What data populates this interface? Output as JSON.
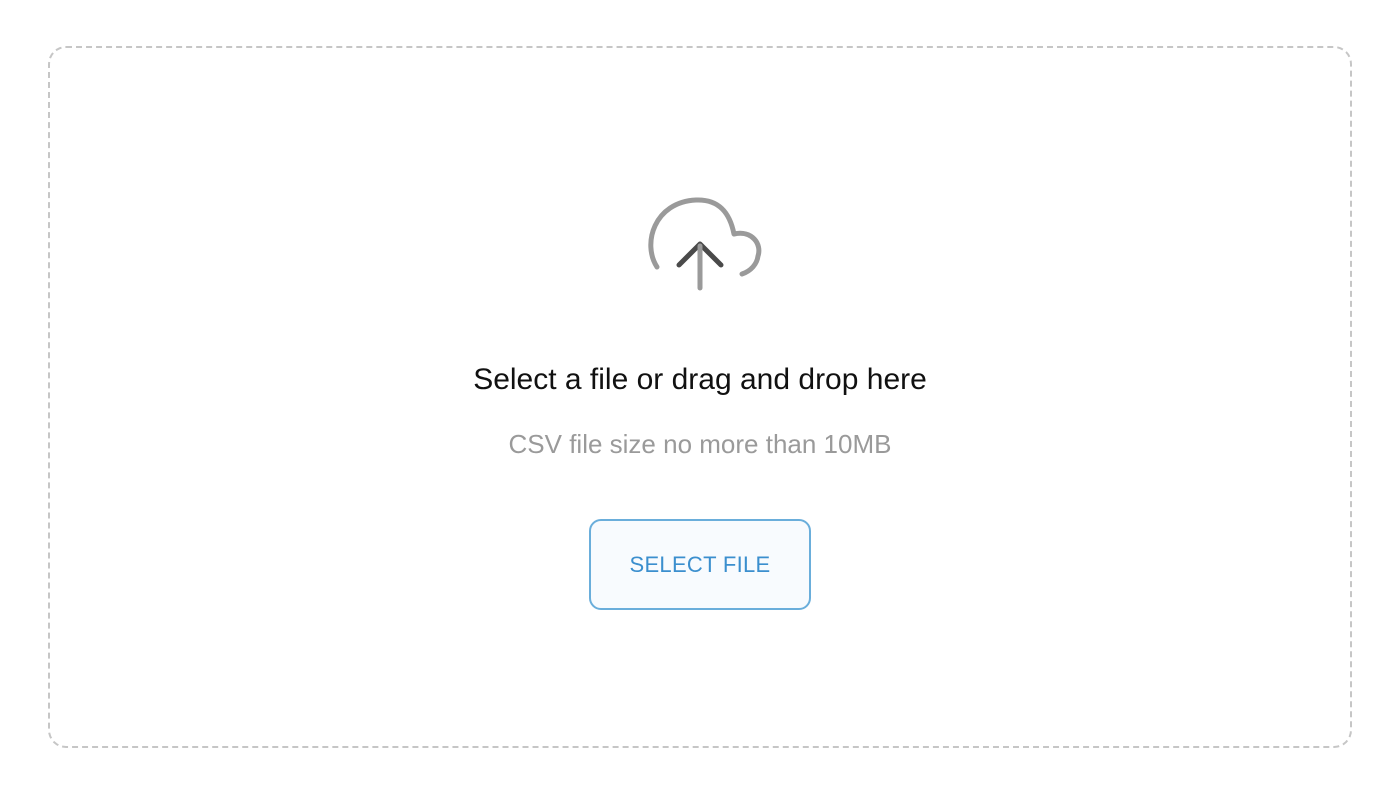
{
  "upload": {
    "icon": "cloud-upload-icon",
    "title": "Select a file or drag and drop here",
    "subtitle": "CSV file size no more than 10MB",
    "button_label": "SELECT FILE"
  },
  "colors": {
    "dashed_border": "#c6c6c6",
    "icon_cloud": "#9a9a9a",
    "icon_arrow": "#4a4a4a",
    "title_text": "#111111",
    "subtitle_text": "#9a9a9a",
    "button_border": "#6aaedb",
    "button_text": "#3b8fce",
    "button_background": "#f8fbfe"
  }
}
